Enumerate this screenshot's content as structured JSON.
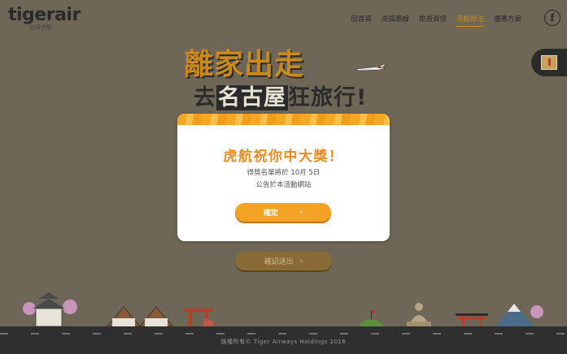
{
  "header": {
    "logo_text": "tigerair",
    "logo_sub": "台灣虎航",
    "nav": [
      {
        "label": "回首頁",
        "active": false
      },
      {
        "label": "虎搞路線",
        "active": false
      },
      {
        "label": "旅遊資訊",
        "active": false
      },
      {
        "label": "活動辦法",
        "active": true
      },
      {
        "label": "優惠方案",
        "active": false
      }
    ],
    "facebook_icon": "f"
  },
  "hero": {
    "line1": "離家出走",
    "line2_pre": "去",
    "line2_hl": "名古屋",
    "line2_post": "狂旅行!"
  },
  "modal": {
    "title": "虎航祝你中大獎！",
    "line1": "得獎名單將於 10月 5日",
    "line2": "公告於本活動網站",
    "confirm_label": "確定",
    "confirm_icon": "›"
  },
  "background_button": {
    "label": "確認送出",
    "icon": "›"
  },
  "footer": {
    "copyright": "版權所有© Tiger Airways Holdings 2016"
  },
  "colors": {
    "accent": "#f4a223",
    "title_orange": "#ef8a1e",
    "overlay_bg": "#6e6657"
  }
}
